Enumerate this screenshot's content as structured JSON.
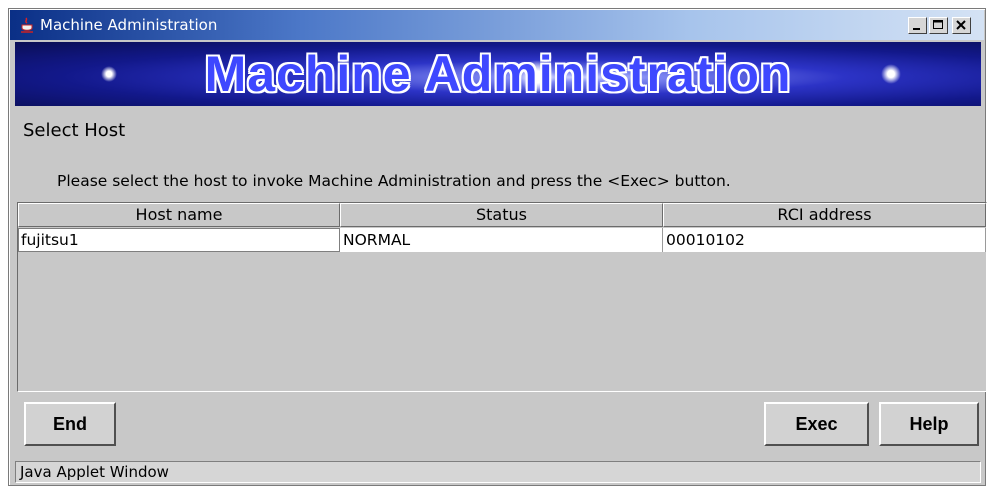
{
  "window": {
    "title": "Machine Administration",
    "controls": {
      "minimize": "minimize-icon",
      "maximize": "maximize-icon",
      "close": "close-icon"
    }
  },
  "banner": {
    "title": "Machine Administration"
  },
  "section": {
    "title": "Select Host"
  },
  "instructions": "Please select the host to invoke Machine Administration and press the <Exec> button.",
  "table": {
    "columns": [
      "Host name",
      "Status",
      "RCI address"
    ],
    "rows": [
      {
        "host_name": "fujitsu1",
        "status": "NORMAL",
        "rci_address": "00010102"
      }
    ]
  },
  "buttons": {
    "end": "End",
    "exec": "Exec",
    "help": "Help"
  },
  "status_bar": {
    "text": "Java Applet Window"
  },
  "colors": {
    "window_bg": "#c8c8c8",
    "titlebar_start": "#0a2f86",
    "titlebar_end": "#d4e2f4",
    "banner_text": "#3e48ff",
    "banner_bg": "#12188a"
  }
}
